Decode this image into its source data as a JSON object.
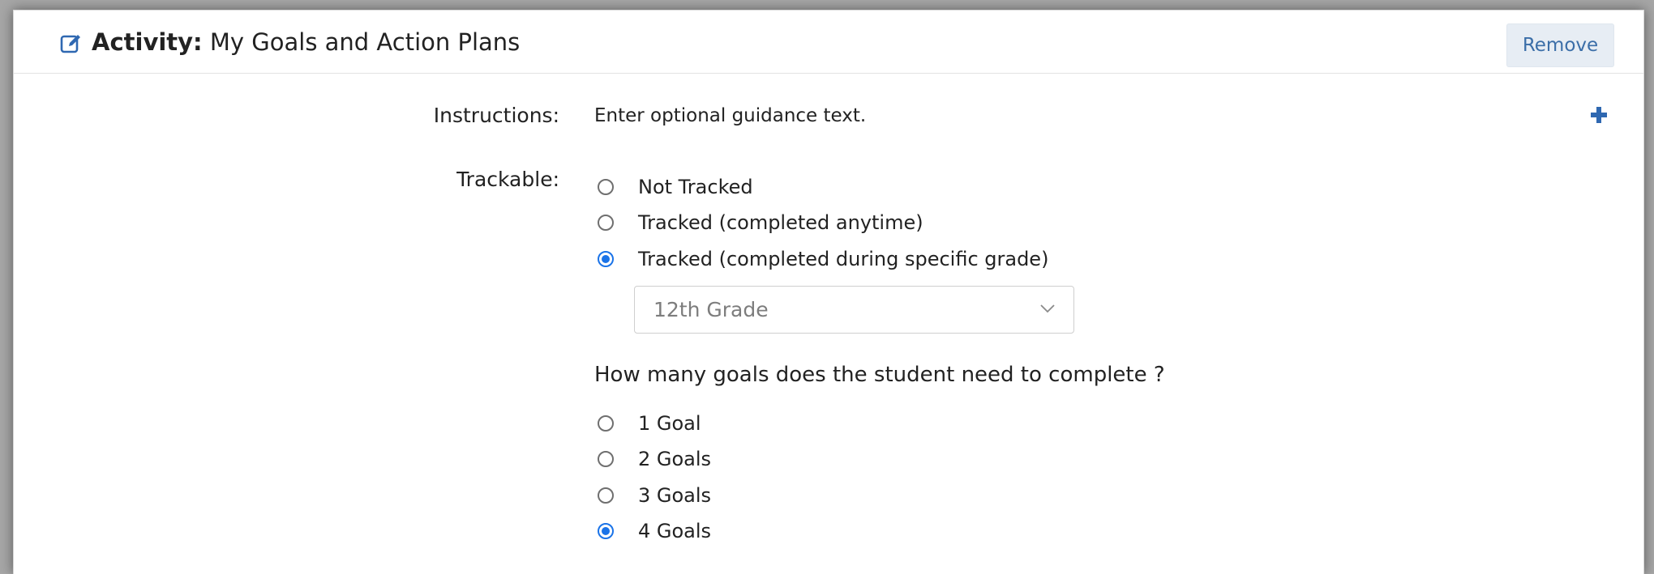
{
  "header": {
    "label": "Activity:",
    "name": "My Goals and Action Plans",
    "edit_icon": "edit-square-icon",
    "remove_label": "Remove"
  },
  "instructions": {
    "label": "Instructions:",
    "text": "Enter optional guidance text.",
    "add_icon": "plus-icon"
  },
  "trackable": {
    "label": "Trackable:",
    "options": [
      {
        "label": "Not Tracked",
        "checked": false
      },
      {
        "label": "Tracked (completed anytime)",
        "checked": false
      },
      {
        "label": "Tracked (completed during specific grade)",
        "checked": true
      }
    ],
    "grade_select": {
      "value": "12th Grade",
      "icon": "chevron-down-icon"
    }
  },
  "goals": {
    "question": "How many goals does the student need to complete ?",
    "options": [
      {
        "label": "1 Goal",
        "checked": false
      },
      {
        "label": "2 Goals",
        "checked": false
      },
      {
        "label": "3 Goals",
        "checked": false
      },
      {
        "label": "4 Goals",
        "checked": true
      }
    ]
  },
  "colors": {
    "accent": "#1a73e8",
    "button_bg": "#e7edf4",
    "button_text": "#3b6ea8",
    "icon_blue": "#2f68b1"
  }
}
